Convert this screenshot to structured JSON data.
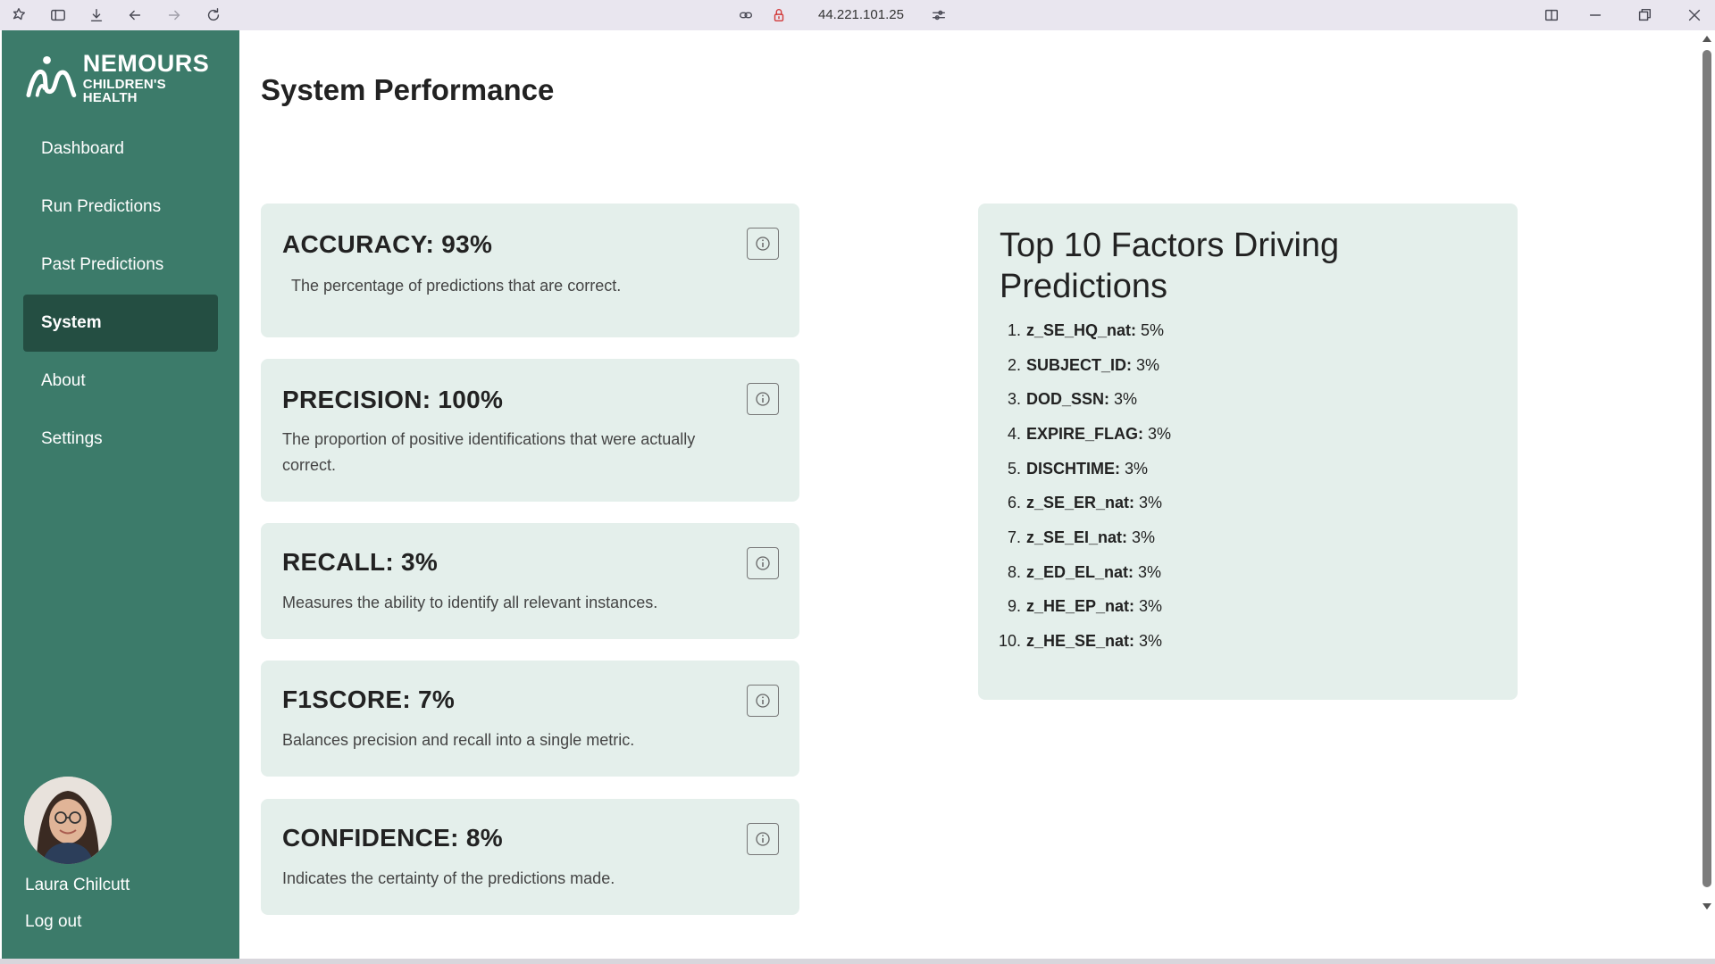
{
  "browser": {
    "url": "44.221.101.25",
    "icons": [
      "extensions-icon",
      "sidebar-toggle-icon",
      "download-icon",
      "back-icon",
      "forward-icon",
      "reload-icon",
      "link-icon",
      "not-secure-lock-icon",
      "site-settings-icon",
      "split-view-icon",
      "minimize-icon",
      "restore-icon",
      "close-icon"
    ]
  },
  "brand": {
    "line1": "NEMOURS",
    "line2": "CHILDREN'S HEALTH",
    "sidebar_color": "#3c7b6a",
    "active_color": "#244e42",
    "card_color": "#e4efeb"
  },
  "nav": {
    "items": [
      {
        "label": "Dashboard",
        "active": false
      },
      {
        "label": "Run Predictions",
        "active": false
      },
      {
        "label": "Past Predictions",
        "active": false
      },
      {
        "label": "System",
        "active": true
      },
      {
        "label": "About",
        "active": false
      },
      {
        "label": "Settings",
        "active": false
      }
    ]
  },
  "user": {
    "name": "Laura Chilcutt",
    "logout_label": "Log out"
  },
  "main": {
    "title": "System Performance",
    "metrics": [
      {
        "title": "ACCURACY: 93%",
        "description": "The percentage of predictions that are correct."
      },
      {
        "title": "PRECISION: 100%",
        "description": "The proportion of positive identifications that were actually correct."
      },
      {
        "title": "RECALL: 3%",
        "description": "Measures the ability to identify all relevant instances."
      },
      {
        "title": "F1SCORE: 7%",
        "description": "Balances precision and recall into a single metric."
      },
      {
        "title": "CONFIDENCE: 8%",
        "description": "Indicates the certainty of the predictions made."
      }
    ],
    "factors": {
      "title": "Top 10 Factors Driving Predictions",
      "items": [
        {
          "num": "1.",
          "name": "z_SE_HQ_nat:",
          "value": " 5%"
        },
        {
          "num": "2.",
          "name": "SUBJECT_ID:",
          "value": " 3%"
        },
        {
          "num": "3.",
          "name": "DOD_SSN:",
          "value": " 3%"
        },
        {
          "num": "4.",
          "name": "EXPIRE_FLAG:",
          "value": " 3%"
        },
        {
          "num": "5.",
          "name": "DISCHTIME:",
          "value": " 3%"
        },
        {
          "num": "6.",
          "name": "z_SE_ER_nat:",
          "value": " 3%"
        },
        {
          "num": "7.",
          "name": "z_SE_EI_nat:",
          "value": " 3%"
        },
        {
          "num": "8.",
          "name": "z_ED_EL_nat:",
          "value": " 3%"
        },
        {
          "num": "9.",
          "name": "z_HE_EP_nat:",
          "value": " 3%"
        },
        {
          "num": "10.",
          "name": "z_HE_SE_nat:",
          "value": " 3%"
        }
      ]
    }
  }
}
